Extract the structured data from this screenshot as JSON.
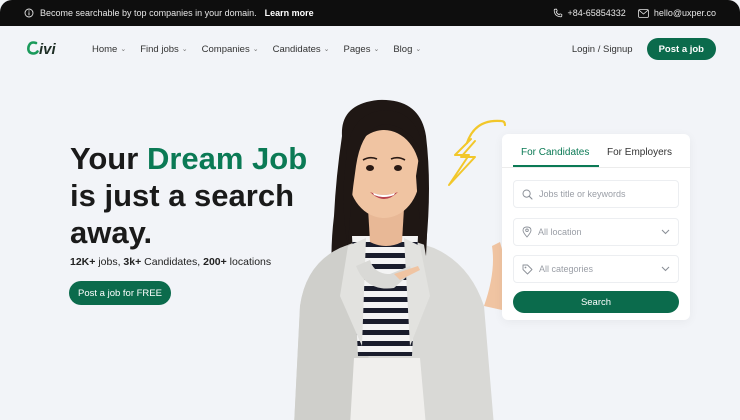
{
  "topbar": {
    "announcement": "Become searchable by top companies in your domain.",
    "learn_more": "Learn more",
    "phone": "+84-65854332",
    "email": "hello@uxper.co"
  },
  "nav": {
    "logo": "Civi",
    "menu": [
      {
        "label": "Home"
      },
      {
        "label": "Find jobs"
      },
      {
        "label": "Companies"
      },
      {
        "label": "Candidates"
      },
      {
        "label": "Pages"
      },
      {
        "label": "Blog"
      }
    ],
    "login": "Login / Signup",
    "post_job": "Post a job"
  },
  "hero": {
    "title_line1_a": "Your ",
    "title_line1_b": "Dream Job",
    "title_line2": "is just a search",
    "title_line3": "away.",
    "stat1_num": "12K+",
    "stat1_text": " jobs, ",
    "stat2_num": "3k+",
    "stat2_text": " Candidates, ",
    "stat3_num": "200+",
    "stat3_text": " locations",
    "cta": "Post a job for FREE"
  },
  "search_card": {
    "tab_candidates": "For Candidates",
    "tab_employers": "For Employers",
    "keywords_placeholder": "Jobs title or keywords",
    "location_value": "All location",
    "category_value": "All categories",
    "search_button": "Search"
  },
  "colors": {
    "brand_green": "#0b6b4c",
    "accent_yellow": "#f2c72a",
    "background": "#f2f4f8"
  }
}
